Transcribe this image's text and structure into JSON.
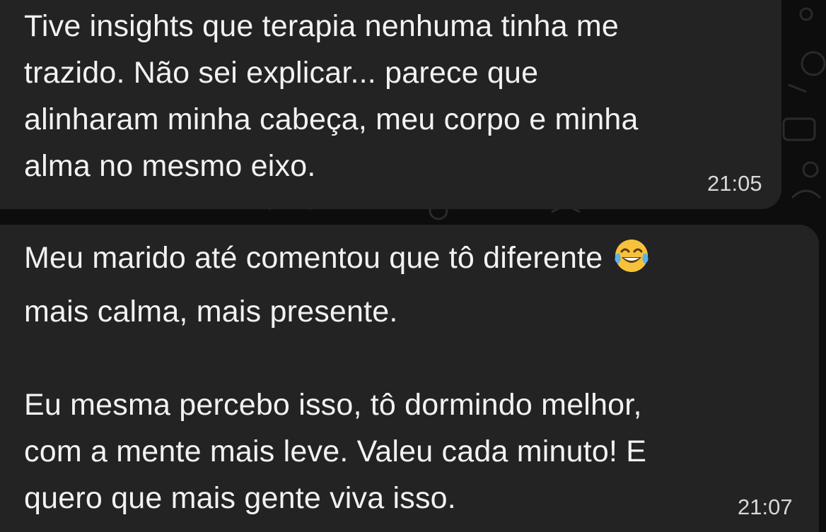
{
  "messages": [
    {
      "lines": [
        "Tive insights que terapia nenhuma tinha me",
        "trazido. Não sei explicar... parece que",
        "alinharam minha cabeça, meu corpo e minha",
        "alma no mesmo eixo."
      ],
      "time": "21:05"
    },
    {
      "paragraph1": [
        "Meu marido até comentou que tô diferente",
        "mais calma, mais presente."
      ],
      "paragraph2": [
        "Eu mesma percebo isso, tô dormindo melhor,",
        "com a mente mais leve. Valeu cada minuto! E",
        "quero que mais gente viva isso."
      ],
      "emoji": "face-with-tears-of-joy-icon",
      "time": "21:07"
    }
  ],
  "colors": {
    "background": "#0d0d0d",
    "bubble": "#232323",
    "text": "#f2f2f2",
    "timestamp": "#d8d8d8"
  }
}
